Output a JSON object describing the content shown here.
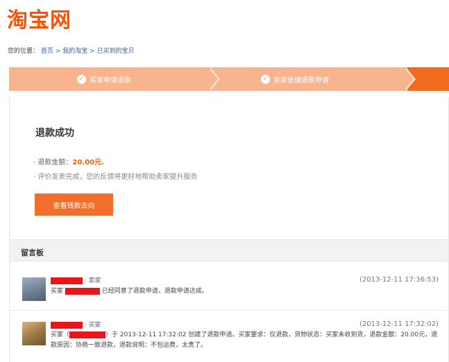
{
  "logo": {
    "text": "淘宝网"
  },
  "breadcrumb": {
    "prefix": "您的位置：",
    "items": [
      "首页",
      "我的淘宝",
      "已买到的宝贝"
    ],
    "separator": ">"
  },
  "steps": [
    {
      "label": "买家申请退款"
    },
    {
      "label": "卖家处理退款申请"
    }
  ],
  "result": {
    "title": "退款成功",
    "amount_prefix": "· 退款金额：",
    "amount": "20.00元",
    "amount_suffix": "。",
    "note": "· 评价发表完成，您的反馈将更好地帮助卖家提升服务"
  },
  "track_button": {
    "label": "查看钱款去向"
  },
  "message_board": {
    "title": "留言板",
    "messages": [
      {
        "role": "· 卖家",
        "time": "(2013-12-11 17:36:53)",
        "prefix": "买家",
        "text": "已经同意了退款申请，退款申请达成。"
      },
      {
        "role": "· 买家",
        "time": "(2013-12-11 17:32:02)",
        "prefix": "买家（",
        "text": "）于 2013-12-11 17:32:02 创建了退款申请。买家要求：仅退款，货物状态：买家未收到货，退款金额：20.00元，退款原因：协商一致退款，退款说明：不包运费，太贵了。"
      }
    ]
  },
  "colors": {
    "brand": "#ff5000",
    "step_bar": "#f7b48f",
    "step_active": "#f26b1d",
    "button": "#f26f2b",
    "redaction": "#e8161b"
  }
}
